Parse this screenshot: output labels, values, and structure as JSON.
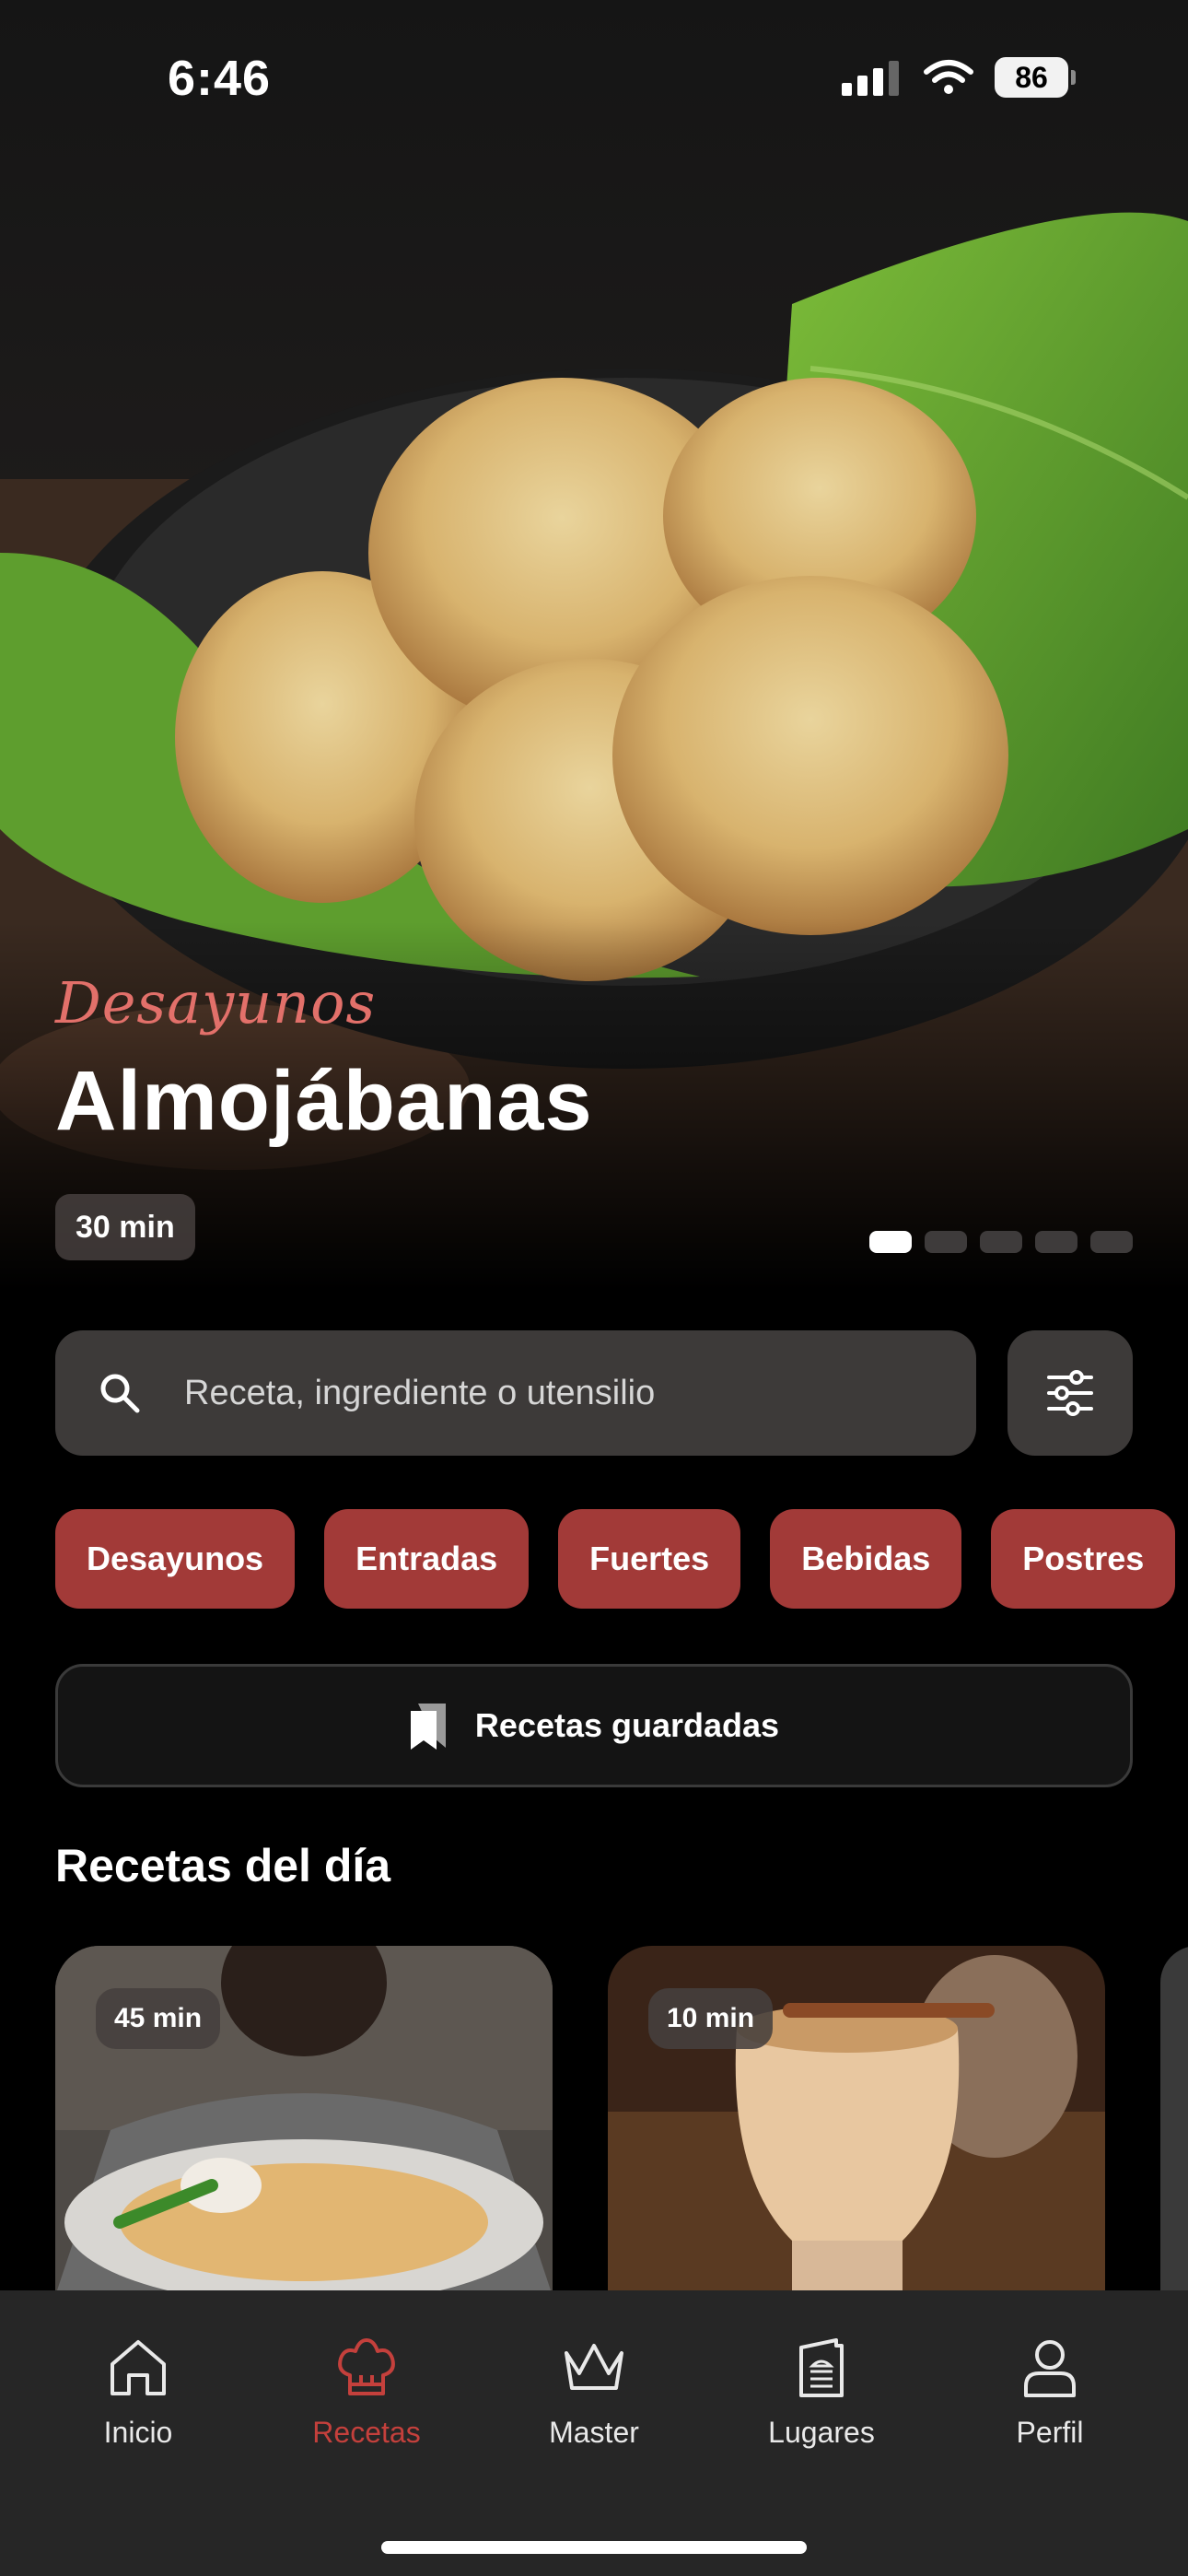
{
  "status_bar": {
    "time": "6:46",
    "battery": "86"
  },
  "hero": {
    "category": "Desayunos",
    "title": "Almojábanas",
    "time_badge": "30 min",
    "carousel": {
      "count": 5,
      "active_index": 0
    }
  },
  "search": {
    "placeholder": "Receta, ingrediente o utensilio",
    "value": ""
  },
  "categories": [
    "Desayunos",
    "Entradas",
    "Fuertes",
    "Bebidas",
    "Postres"
  ],
  "saved_recipes": {
    "label": "Recetas guardadas"
  },
  "recipes_of_day": {
    "title": "Recetas del día",
    "cards": [
      {
        "time": "45 min"
      },
      {
        "time": "10 min"
      }
    ]
  },
  "tabbar": {
    "items": [
      {
        "label": "Inicio",
        "icon": "home-icon"
      },
      {
        "label": "Recetas",
        "icon": "chef-hat-icon",
        "active": true
      },
      {
        "label": "Master",
        "icon": "crown-icon"
      },
      {
        "label": "Lugares",
        "icon": "menu-document-icon"
      },
      {
        "label": "Perfil",
        "icon": "user-icon"
      }
    ]
  },
  "colors": {
    "accent": "#a23a38",
    "accent_text": "#c4403c",
    "category_script": "#e2706a",
    "surface": "#3d3a39",
    "tabbar": "#262626"
  }
}
